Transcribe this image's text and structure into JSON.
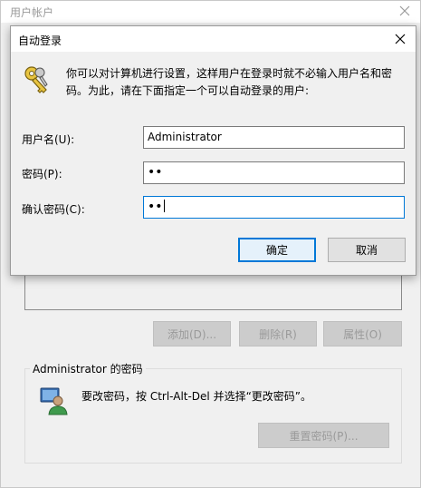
{
  "parent_window": {
    "title": "用户帐户",
    "buttons": {
      "add": "添加(D)...",
      "remove": "删除(R)",
      "properties": "属性(O)"
    },
    "password_group": {
      "title": "Administrator 的密码",
      "text": "要改密码，按 Ctrl-Alt-Del 并选择“更改密码”。",
      "reset_button": "重置密码(P)..."
    }
  },
  "dialog": {
    "title": "自动登录",
    "info": "你可以对计算机进行设置，这样用户在登录时就不必输入用户名和密码。为此，请在下面指定一个可以自动登录的用户:",
    "fields": {
      "username_label": "用户名(U):",
      "username_value": "Administrator",
      "password_label": "密码(P):",
      "password_value": "••",
      "confirm_label": "确认密码(C):",
      "confirm_value": "••"
    },
    "ok_label": "确定",
    "cancel_label": "取消"
  },
  "icons": [
    "close-icon",
    "keys-icon",
    "user-icon"
  ],
  "colors": {
    "accent": "#0078d7",
    "background": "#f0f0f0"
  }
}
